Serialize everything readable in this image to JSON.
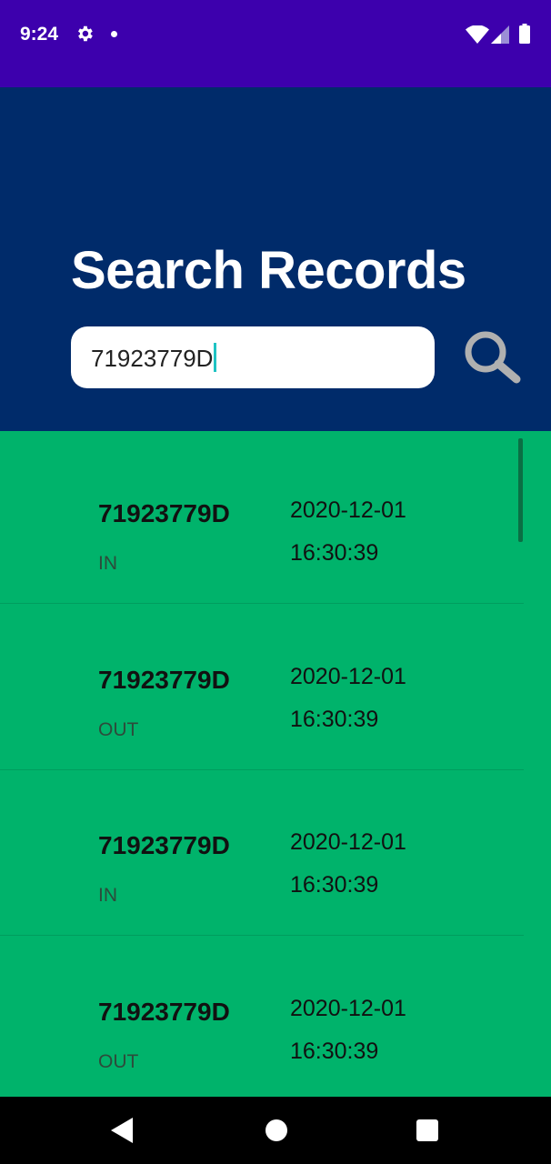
{
  "status_bar": {
    "time": "9:24",
    "icons": [
      "gear-icon",
      "dot-icon",
      "wifi-icon",
      "signal-icon",
      "battery-icon"
    ]
  },
  "header": {
    "title": "Search Records",
    "search_value": "71923779D",
    "search_icon": "search-icon"
  },
  "records": [
    {
      "id": "71923779D",
      "type": "IN",
      "date": "2020-12-01",
      "time": "16:30:39"
    },
    {
      "id": "71923779D",
      "type": "OUT",
      "date": "2020-12-01",
      "time": "16:30:39"
    },
    {
      "id": "71923779D",
      "type": "IN",
      "date": "2020-12-01",
      "time": "16:30:39"
    },
    {
      "id": "71923779D",
      "type": "OUT",
      "date": "2020-12-01",
      "time": "16:30:39"
    }
  ],
  "nav_bar": {
    "icons": [
      "back-icon",
      "home-icon",
      "recents-icon"
    ]
  },
  "colors": {
    "status_bar": "#3d00ad",
    "header": "#002b6a",
    "list_background": "#00b36b",
    "caret": "#1fc3c3"
  }
}
